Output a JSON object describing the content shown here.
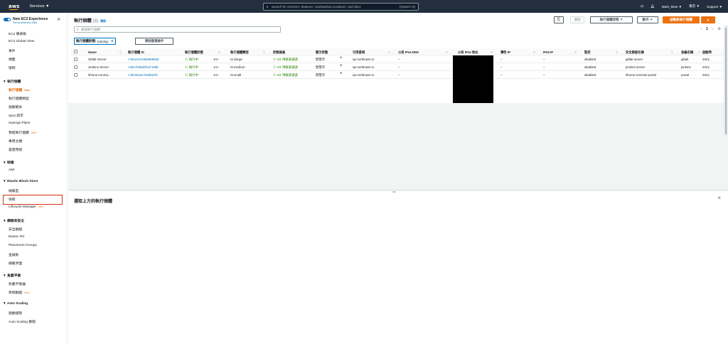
{
  "topbar": {
    "logo": "aws",
    "services": "Services ▼",
    "search_placeholder": "Search for services, features, marketplace products, and docs",
    "search_shortcut": "[Option+S]",
    "user": "Mark_Mew ▼",
    "region": "東京 ▼",
    "support": "Support ▼"
  },
  "sidebar": {
    "header": "New EC2 Experience",
    "subheader": "Tell us what you think",
    "new_badge": "New",
    "items": [
      {
        "label": "EC2 儀表板"
      },
      {
        "label": "EC2 Global View"
      },
      {
        "label": "事件"
      },
      {
        "label": "標籤"
      },
      {
        "label": "限制"
      }
    ],
    "sections": [
      {
        "title": "執行個體",
        "items": [
          {
            "label": "執行個體",
            "new": true,
            "active": true
          },
          {
            "label": "執行個體類型"
          },
          {
            "label": "啟動範本"
          },
          {
            "label": "Spot 請求"
          },
          {
            "label": "Savings Plans"
          },
          {
            "label": "預留執行個體",
            "new": true
          },
          {
            "label": "專用主機"
          },
          {
            "label": "容量預留"
          }
        ]
      },
      {
        "title": "映像",
        "items": [
          {
            "label": "AMI"
          }
        ]
      },
      {
        "title": "Elastic Block Store",
        "items": [
          {
            "label": "磁碟區"
          },
          {
            "label": "快照"
          },
          {
            "label": "Lifecycle Manager",
            "new": true
          }
        ]
      },
      {
        "title": "網路和安全",
        "items": [
          {
            "label": "安全群組"
          },
          {
            "label": "Elastic IPs"
          },
          {
            "label": "Placement Groups"
          },
          {
            "label": "金鑰對"
          },
          {
            "label": "網路界面"
          }
        ]
      },
      {
        "title": "負載平衡",
        "items": [
          {
            "label": "負載平衡器"
          },
          {
            "label": "目標群組",
            "new": true
          }
        ]
      },
      {
        "title": "Auto Scaling",
        "items": [
          {
            "label": "啟動組態"
          },
          {
            "label": "Auto Scaling 群組"
          }
        ]
      }
    ]
  },
  "main": {
    "title": "執行個體",
    "count": "(3)",
    "info": "資訊",
    "buttons": {
      "refresh": "C",
      "connect": "連接",
      "state": "執行個體狀態 ▼",
      "actions": "動作 ▼",
      "launch": "啟動新執行個體",
      "launch_menu": "▼"
    },
    "filter_placeholder": "篩選執行個體",
    "token_key": "執行個體狀態:",
    "token_value": "running",
    "clear_filters": "清除篩選條件",
    "pager": {
      "page": "1"
    },
    "columns": [
      "Name",
      "執行個體 ID",
      "執行個體狀態",
      "執行個體類型",
      "狀態檢查",
      "警示狀態",
      "可用區域",
      "公有 IPv4 DNS",
      "公有 IPv4 地址",
      "彈性 IP",
      "IPv6 IP",
      "監控",
      "安全群組名稱",
      "金鑰名稱",
      "啟動時"
    ],
    "rows": [
      {
        "name": "Gitlab Server",
        "id": "i-05ace0c468a9866bd",
        "state": "執行中",
        "type": "t3.xlarge",
        "check": "2/2 項檢查通過",
        "alarm": "無警示",
        "az": "ap-northeast-1c",
        "dns": "–",
        "eip": "–",
        "ipv6": "–",
        "monitor": "disabled",
        "sg": "gitlab-server",
        "key": "gitlab",
        "launch": "2021,"
      },
      {
        "name": "Jenkins Server",
        "id": "i-0917bd9d2f1d7108b",
        "state": "執行中",
        "type": "t3.medium",
        "check": "2/2 項檢查通過",
        "alarm": "無警示",
        "az": "ap-northeast-1c",
        "dns": "–",
        "eip": "–",
        "ipv6": "–",
        "monitor": "disabled",
        "sg": "jenkins-server",
        "key": "jenkins",
        "launch": "2021,"
      },
      {
        "name": "ithome ironma...",
        "id": "i-0dc5b2ac7625820fc",
        "state": "執行中",
        "type": "t3.small",
        "check": "2/2 項檢查通過",
        "alarm": "無警示",
        "az": "ap-northeast-1c",
        "dns": "–",
        "eip": "–",
        "ipv6": "–",
        "monitor": "disabled",
        "sg": "ithome-ironman-portal",
        "key": "portal",
        "launch": "2021,"
      }
    ],
    "detail": {
      "title": "選取上方的執行個體"
    }
  },
  "colors": {
    "topbar": "#232f3e",
    "accent": "#ec7211",
    "link": "#0073bb",
    "success": "#1d8102"
  }
}
